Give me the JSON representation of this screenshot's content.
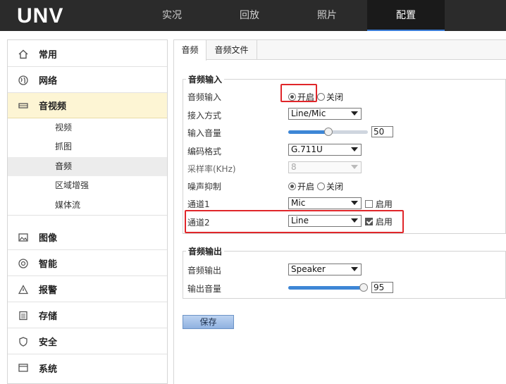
{
  "brand": {
    "logo": "UNV"
  },
  "topnav": {
    "tabs": [
      {
        "label": "实况"
      },
      {
        "label": "回放"
      },
      {
        "label": "照片"
      },
      {
        "label": "配置"
      }
    ],
    "active_index": 3
  },
  "sidebar": {
    "items": [
      {
        "label": "常用",
        "icon": "home-icon"
      },
      {
        "label": "网络",
        "icon": "globe-icon"
      },
      {
        "label": "音视频",
        "icon": "video-icon"
      },
      {
        "label": "图像",
        "icon": "image-icon"
      },
      {
        "label": "智能",
        "icon": "smart-icon"
      },
      {
        "label": "报警",
        "icon": "alarm-icon"
      },
      {
        "label": "存储",
        "icon": "storage-icon"
      },
      {
        "label": "安全",
        "icon": "shield-icon"
      },
      {
        "label": "系统",
        "icon": "system-icon"
      }
    ],
    "sub_items": [
      {
        "label": "视频"
      },
      {
        "label": "抓图"
      },
      {
        "label": "音频"
      },
      {
        "label": "区域增强"
      },
      {
        "label": "媒体流"
      }
    ],
    "active_sub": "音频"
  },
  "subtabs": [
    {
      "label": "音频"
    },
    {
      "label": "音频文件"
    }
  ],
  "audio_input": {
    "legend": "音频输入",
    "rows": {
      "audio_input": {
        "label": "音频输入",
        "on_label": "开启",
        "off_label": "关闭",
        "value": "开启"
      },
      "access_mode": {
        "label": "接入方式",
        "value": "Line/Mic"
      },
      "input_volume": {
        "label": "输入音量",
        "value": "50",
        "level": 0.5
      },
      "encoding": {
        "label": "编码格式",
        "value": "G.711U"
      },
      "sample_rate": {
        "label": "采样率(KHz)",
        "value": "8"
      },
      "noise": {
        "label": "噪声抑制",
        "on_label": "开启",
        "off_label": "关闭",
        "value": "开启"
      },
      "channel1": {
        "label": "通道1",
        "value": "Mic",
        "enable_label": "启用",
        "enabled": false
      },
      "channel2": {
        "label": "通道2",
        "value": "Line",
        "enable_label": "启用",
        "enabled": true
      }
    }
  },
  "audio_output": {
    "legend": "音频输出",
    "rows": {
      "audio_output": {
        "label": "音频输出",
        "value": "Speaker"
      },
      "output_volume": {
        "label": "输出音量",
        "value": "95",
        "level": 0.95
      }
    }
  },
  "save_label": "保存",
  "colors": {
    "highlight_box": "#e0262a",
    "accent": "#3d86d6",
    "topbar": "#2b2b2b"
  }
}
